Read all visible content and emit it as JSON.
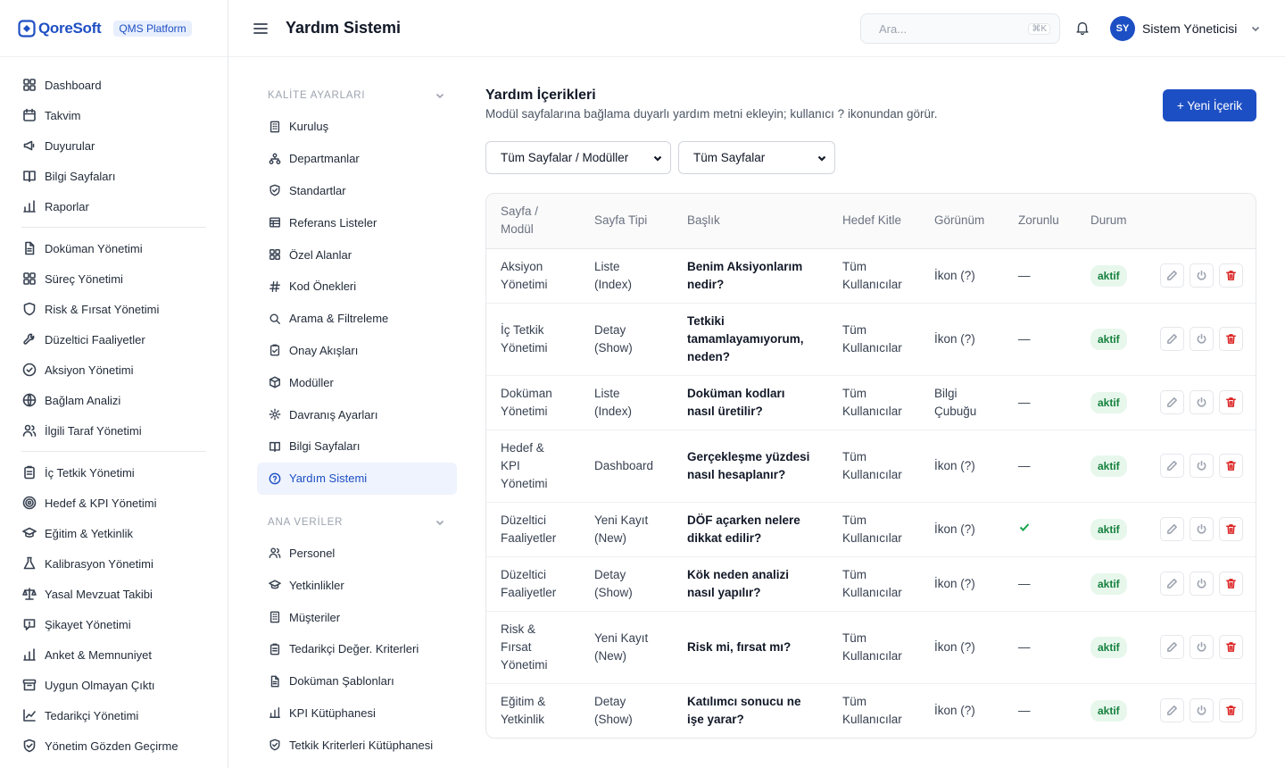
{
  "brand": {
    "name": "QoreSoft",
    "badge": "QMS Platform"
  },
  "header": {
    "title": "Yardım Sistemi",
    "search_placeholder": "Ara...",
    "search_shortcut": "⌘K",
    "user_initials": "SY",
    "user_name": "Sistem Yöneticisi"
  },
  "sidebar": {
    "groups": [
      [
        {
          "label": "Dashboard",
          "icon": "dashboard-icon"
        },
        {
          "label": "Takvim",
          "icon": "calendar-icon"
        },
        {
          "label": "Duyurular",
          "icon": "megaphone-icon"
        },
        {
          "label": "Bilgi Sayfaları",
          "icon": "book-icon"
        },
        {
          "label": "Raporlar",
          "icon": "bar-chart-icon"
        }
      ],
      [
        {
          "label": "Doküman Yönetimi",
          "icon": "document-icon"
        },
        {
          "label": "Süreç Yönetimi",
          "icon": "grid-icon"
        },
        {
          "label": "Risk & Fırsat Yönetimi",
          "icon": "shield-icon"
        },
        {
          "label": "Düzeltici Faaliyetler",
          "icon": "wrench-icon"
        },
        {
          "label": "Aksiyon Yönetimi",
          "icon": "check-circle-icon"
        },
        {
          "label": "Bağlam Analizi",
          "icon": "globe-icon"
        },
        {
          "label": "İlgili Taraf Yönetimi",
          "icon": "users-icon"
        }
      ],
      [
        {
          "label": "İç Tetkik Yönetimi",
          "icon": "clipboard-icon"
        },
        {
          "label": "Hedef & KPI Yönetimi",
          "icon": "target-icon"
        },
        {
          "label": "Eğitim & Yetkinlik",
          "icon": "graduation-cap-icon"
        },
        {
          "label": "Kalibrasyon Yönetimi",
          "icon": "flask-icon"
        },
        {
          "label": "Yasal Mevzuat Takibi",
          "icon": "scale-icon"
        },
        {
          "label": "Şikayet Yönetimi",
          "icon": "complaint-icon"
        },
        {
          "label": "Anket & Memnuniyet",
          "icon": "survey-chart-icon"
        },
        {
          "label": "Uygun Olmayan Çıktı",
          "icon": "archive-icon"
        },
        {
          "label": "Tedarikçi Yönetimi",
          "icon": "line-chart-icon"
        },
        {
          "label": "Yönetim Gözden Geçirme",
          "icon": "shield-check-icon"
        }
      ]
    ]
  },
  "subnav": {
    "groups": [
      {
        "title": "KALİTE AYARLARI",
        "items": [
          {
            "label": "Kuruluş",
            "icon": "building-icon"
          },
          {
            "label": "Departmanlar",
            "icon": "org-chart-icon"
          },
          {
            "label": "Standartlar",
            "icon": "shield-check-icon"
          },
          {
            "label": "Referans Listeler",
            "icon": "table-icon"
          },
          {
            "label": "Özel Alanlar",
            "icon": "grid-icon"
          },
          {
            "label": "Kod Önekleri",
            "icon": "hash-icon"
          },
          {
            "label": "Arama & Filtreleme",
            "icon": "search-icon"
          },
          {
            "label": "Onay Akışları",
            "icon": "clipboard-check-icon"
          },
          {
            "label": "Modüller",
            "icon": "package-icon"
          },
          {
            "label": "Davranış Ayarları",
            "icon": "gear-icon"
          },
          {
            "label": "Bilgi Sayfaları",
            "icon": "book-icon"
          },
          {
            "label": "Yardım Sistemi",
            "icon": "help-circle-icon",
            "active": true
          }
        ]
      },
      {
        "title": "ANA VERİLER",
        "items": [
          {
            "label": "Personel",
            "icon": "users-icon"
          },
          {
            "label": "Yetkinlikler",
            "icon": "graduation-cap-icon"
          },
          {
            "label": "Müşteriler",
            "icon": "building-icon"
          },
          {
            "label": "Tedarikçi Değer. Kriterleri",
            "icon": "clipboard-icon"
          },
          {
            "label": "Doküman Şablonları",
            "icon": "document-icon"
          },
          {
            "label": "KPI Kütüphanesi",
            "icon": "bar-chart-icon"
          },
          {
            "label": "Tetkik Kriterleri Kütüphanesi",
            "icon": "shield-check-icon"
          }
        ]
      }
    ]
  },
  "content": {
    "title": "Yardım İçerikleri",
    "subtitle": "Modül sayfalarına bağlama duyarlı yardım metni ekleyin; kullanıcı ? ikonundan görür.",
    "new_button": "+ Yeni İçerik",
    "filter_module": "Tüm Sayfalar / Modüller",
    "filter_page": "Tüm Sayfalar",
    "columns": [
      "Sayfa / Modül",
      "Sayfa Tipi",
      "Başlık",
      "Hedef Kitle",
      "Görünüm",
      "Zorunlu",
      "Durum"
    ],
    "rows": [
      {
        "module": "Aksiyon Yönetimi",
        "type": "Liste (Index)",
        "title": "Benim Aksiyonlarım nedir?",
        "audience": "Tüm Kullanıcılar",
        "view": "İkon (?)",
        "required": "—",
        "status": "aktif"
      },
      {
        "module": "İç Tetkik Yönetimi",
        "type": "Detay (Show)",
        "title": "Tetkiki tamamlayamıyorum, neden?",
        "audience": "Tüm Kullanıcılar",
        "view": "İkon (?)",
        "required": "—",
        "status": "aktif"
      },
      {
        "module": "Doküman Yönetimi",
        "type": "Liste (Index)",
        "title": "Doküman kodları nasıl üretilir?",
        "audience": "Tüm Kullanıcılar",
        "view": "Bilgi Çubuğu",
        "required": "—",
        "status": "aktif"
      },
      {
        "module": "Hedef & KPI Yönetimi",
        "type": "Dashboard",
        "title": "Gerçekleşme yüzdesi nasıl hesaplanır?",
        "audience": "Tüm Kullanıcılar",
        "view": "İkon (?)",
        "required": "—",
        "status": "aktif"
      },
      {
        "module": "Düzeltici Faaliyetler",
        "type": "Yeni Kayıt (New)",
        "title": "DÖF açarken nelere dikkat edilir?",
        "audience": "Tüm Kullanıcılar",
        "view": "İkon (?)",
        "required": "✓",
        "status": "aktif"
      },
      {
        "module": "Düzeltici Faaliyetler",
        "type": "Detay (Show)",
        "title": "Kök neden analizi nasıl yapılır?",
        "audience": "Tüm Kullanıcılar",
        "view": "İkon (?)",
        "required": "—",
        "status": "aktif"
      },
      {
        "module": "Risk & Fırsat Yönetimi",
        "type": "Yeni Kayıt (New)",
        "title": "Risk mi, fırsat mı?",
        "audience": "Tüm Kullanıcılar",
        "view": "İkon (?)",
        "required": "—",
        "status": "aktif"
      },
      {
        "module": "Eğitim & Yetkinlik",
        "type": "Detay (Show)",
        "title": "Katılımcı sonucu ne işe yarar?",
        "audience": "Tüm Kullanıcılar",
        "view": "İkon (?)",
        "required": "—",
        "status": "aktif"
      }
    ]
  },
  "colors": {
    "primary": "#1d4fc4",
    "active_bg": "#eef3fd",
    "success_bg": "#e7f7ec",
    "success_text": "#15803d",
    "danger": "#dc2626"
  }
}
